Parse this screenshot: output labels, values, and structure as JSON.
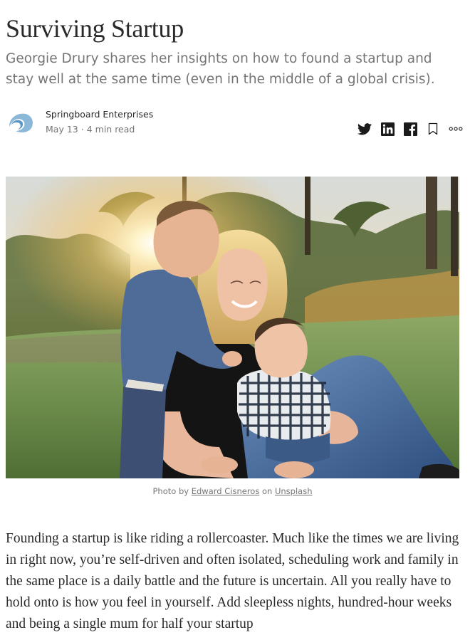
{
  "article": {
    "title": "Surviving Startup",
    "subtitle": "Georgie Drury shares her insights on how to found a startup and stay well at the same time (even in the middle of a global crisis)."
  },
  "byline": {
    "author": "Springboard Enterprises",
    "date": "May 13",
    "separator": "·",
    "read_time": "4 min read"
  },
  "actions": {
    "icons": [
      "twitter-icon",
      "linkedin-icon",
      "facebook-icon",
      "bookmark-icon",
      "more-icon"
    ]
  },
  "image_caption": {
    "prefix": "Photo by ",
    "photographer": "Edward Cisneros",
    "middle": " on ",
    "source": "Unsplash"
  },
  "body": {
    "paragraph_1": "Founding a startup is like riding a rollercoaster. Much like the times we are living in right now, you’re self-driven and often isolated, scheduling work and family in the same place is a daily battle and the future is uncertain. All you really have to hold onto is how you feel in yourself. Add sleepless nights, hundred-hour weeks and being a single mum for half your startup"
  },
  "colors": {
    "text": "#292929",
    "muted": "#757575",
    "logo_blue": "#8bb8d8"
  }
}
